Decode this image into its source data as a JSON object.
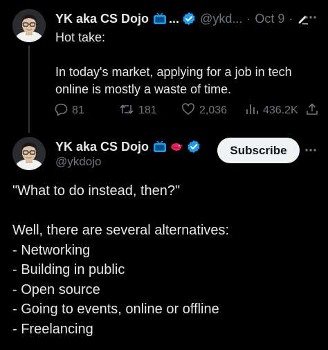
{
  "colors": {
    "background": "#000000",
    "text": "#e7e9ea",
    "muted": "#71767b",
    "verified": "#1d9bf0",
    "tv_badge": "#1d9bf0",
    "subscribe_bg": "#eff3f4"
  },
  "parent_tweet": {
    "author_name": "YK aka CS Dojo",
    "badge_suffix": "...",
    "handle": "@ykd...",
    "separator": "·",
    "date": "Oct 9",
    "separator2": "·",
    "icons": [
      "tv-icon",
      "verified-icon",
      "edit-icon",
      "more-icon"
    ],
    "body": {
      "line1": "Hot take:",
      "line2": "In today's market, applying for a job in tech",
      "line3": "online is mostly a waste of time."
    },
    "actions": {
      "replies": "81",
      "reposts": "181",
      "likes": "2,036",
      "views": "436.2K"
    }
  },
  "reply_tweet": {
    "author_name": "YK aka CS Dojo",
    "handle": "@ykdojo",
    "subscribe_label": "Subscribe",
    "icons": [
      "tv-icon",
      "bird-icon",
      "verified-icon",
      "more-icon"
    ],
    "body": {
      "quote": "\"What to do instead, then?\"",
      "intro": "Well, there are several alternatives:",
      "items": [
        "- Networking",
        "- Building in public",
        "- Open source",
        "- Going to events, online or offline",
        "- Freelancing"
      ]
    }
  }
}
